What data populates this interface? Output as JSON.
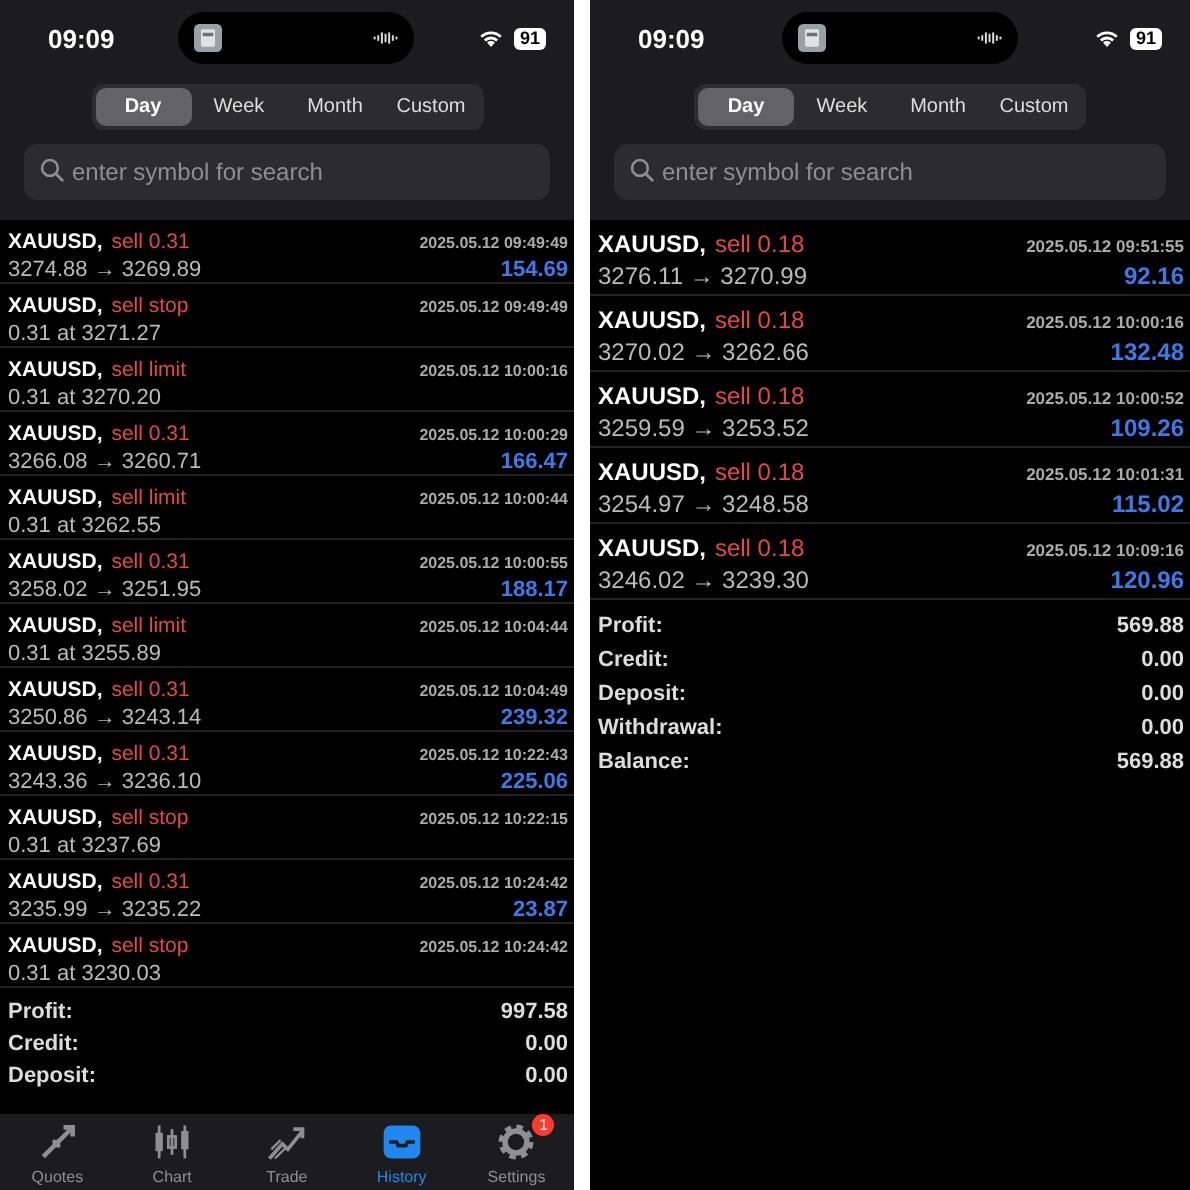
{
  "panels": [
    {
      "status_bar": {
        "time": "09:09",
        "battery": "91"
      },
      "periods": [
        {
          "label": "Day",
          "selected": true
        },
        {
          "label": "Week",
          "selected": false
        },
        {
          "label": "Month",
          "selected": false
        },
        {
          "label": "Custom",
          "selected": false
        }
      ],
      "search": {
        "placeholder": "enter symbol for search"
      },
      "deals": [
        {
          "symbol": "XAUUSD,",
          "action": "sell 0.31",
          "time": "2025.05.12 09:49:49",
          "prices": "3274.88 → 3269.89",
          "profit": "154.69"
        },
        {
          "symbol": "XAUUSD,",
          "action": "sell stop",
          "time": "2025.05.12 09:49:49",
          "prices": "0.31 at 3271.27"
        },
        {
          "symbol": "XAUUSD,",
          "action": "sell limit",
          "time": "2025.05.12 10:00:16",
          "prices": "0.31 at 3270.20"
        },
        {
          "symbol": "XAUUSD,",
          "action": "sell 0.31",
          "time": "2025.05.12 10:00:29",
          "prices": "3266.08 → 3260.71",
          "profit": "166.47"
        },
        {
          "symbol": "XAUUSD,",
          "action": "sell limit",
          "time": "2025.05.12 10:00:44",
          "prices": "0.31 at 3262.55"
        },
        {
          "symbol": "XAUUSD,",
          "action": "sell 0.31",
          "time": "2025.05.12 10:00:55",
          "prices": "3258.02 → 3251.95",
          "profit": "188.17"
        },
        {
          "symbol": "XAUUSD,",
          "action": "sell limit",
          "time": "2025.05.12 10:04:44",
          "prices": "0.31 at 3255.89"
        },
        {
          "symbol": "XAUUSD,",
          "action": "sell 0.31",
          "time": "2025.05.12 10:04:49",
          "prices": "3250.86 → 3243.14",
          "profit": "239.32"
        },
        {
          "symbol": "XAUUSD,",
          "action": "sell 0.31",
          "time": "2025.05.12 10:22:43",
          "prices": "3243.36 → 3236.10",
          "profit": "225.06"
        },
        {
          "symbol": "XAUUSD,",
          "action": "sell stop",
          "time": "2025.05.12 10:22:15",
          "prices": "0.31 at 3237.69"
        },
        {
          "symbol": "XAUUSD,",
          "action": "sell 0.31",
          "time": "2025.05.12 10:24:42",
          "prices": "3235.99 → 3235.22",
          "profit": "23.87"
        },
        {
          "symbol": "XAUUSD,",
          "action": "sell stop",
          "time": "2025.05.12 10:24:42",
          "prices": "0.31 at 3230.03"
        }
      ],
      "summary": [
        {
          "label": "Profit:",
          "value": "997.58"
        },
        {
          "label": "Credit:",
          "value": "0.00"
        },
        {
          "label": "Deposit:",
          "value": "0.00"
        }
      ],
      "tab_bar": [
        {
          "label": "Quotes",
          "selected": false
        },
        {
          "label": "Chart",
          "selected": false
        },
        {
          "label": "Trade",
          "selected": false
        },
        {
          "label": "History",
          "selected": true
        },
        {
          "label": "Settings",
          "selected": false,
          "badge": "1"
        }
      ]
    },
    {
      "status_bar": {
        "time": "09:09",
        "battery": "91"
      },
      "periods": [
        {
          "label": "Day",
          "selected": true
        },
        {
          "label": "Week",
          "selected": false
        },
        {
          "label": "Month",
          "selected": false
        },
        {
          "label": "Custom",
          "selected": false
        }
      ],
      "search": {
        "placeholder": "enter symbol for search"
      },
      "deals": [
        {
          "symbol": "XAUUSD,",
          "action": "sell 0.18",
          "time": "2025.05.12 09:51:55",
          "prices": "3276.11 → 3270.99",
          "profit": "92.16"
        },
        {
          "symbol": "XAUUSD,",
          "action": "sell 0.18",
          "time": "2025.05.12 10:00:16",
          "prices": "3270.02 → 3262.66",
          "profit": "132.48"
        },
        {
          "symbol": "XAUUSD,",
          "action": "sell 0.18",
          "time": "2025.05.12 10:00:52",
          "prices": "3259.59 → 3253.52",
          "profit": "109.26"
        },
        {
          "symbol": "XAUUSD,",
          "action": "sell 0.18",
          "time": "2025.05.12 10:01:31",
          "prices": "3254.97 → 3248.58",
          "profit": "115.02"
        },
        {
          "symbol": "XAUUSD,",
          "action": "sell 0.18",
          "time": "2025.05.12 10:09:16",
          "prices": "3246.02 → 3239.30",
          "profit": "120.96"
        }
      ],
      "summary": [
        {
          "label": "Profit:",
          "value": "569.88"
        },
        {
          "label": "Credit:",
          "value": "0.00"
        },
        {
          "label": "Deposit:",
          "value": "0.00"
        },
        {
          "label": "Withdrawal:",
          "value": "0.00"
        },
        {
          "label": "Balance:",
          "value": "569.88"
        }
      ]
    }
  ]
}
